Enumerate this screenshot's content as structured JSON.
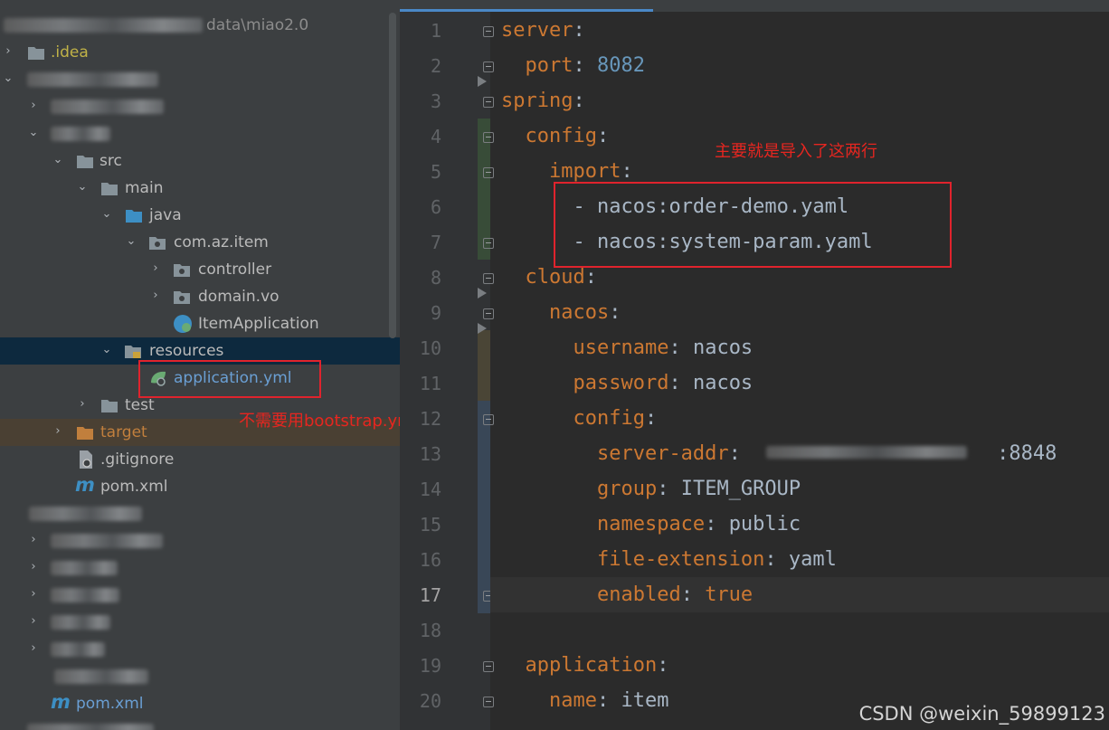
{
  "tree": {
    "project_path": "data\\miao2.0",
    "items": [
      {
        "label": ".idea",
        "style": "yellow"
      },
      {
        "label": "src"
      },
      {
        "label": "main"
      },
      {
        "label": "java"
      },
      {
        "label": "com.az.item"
      },
      {
        "label": "controller"
      },
      {
        "label": "domain.vo"
      },
      {
        "label": "ItemApplication"
      },
      {
        "label": "resources"
      },
      {
        "label": "application.yml",
        "style": "blue"
      },
      {
        "label": "test"
      },
      {
        "label": "target",
        "style": "orange"
      },
      {
        "label": ".gitignore"
      },
      {
        "label": "pom.xml"
      },
      {
        "label": "pom.xml"
      }
    ],
    "annotation": "不需要用bootstrap.yml"
  },
  "editor": {
    "annotation": "主要就是导入了这两行",
    "lines": [
      {
        "n": "1",
        "key": "server",
        "value": ""
      },
      {
        "n": "2",
        "key": "port",
        "value": "8082"
      },
      {
        "n": "3",
        "key": "spring",
        "value": ""
      },
      {
        "n": "4",
        "key": "config",
        "value": ""
      },
      {
        "n": "5",
        "key": "import",
        "value": ""
      },
      {
        "n": "6",
        "item": "- nacos:order-demo.yaml"
      },
      {
        "n": "7",
        "item": "- nacos:system-param.yaml"
      },
      {
        "n": "8",
        "key": "cloud",
        "value": ""
      },
      {
        "n": "9",
        "key": "nacos",
        "value": ""
      },
      {
        "n": "10",
        "key": "username",
        "value": "nacos"
      },
      {
        "n": "11",
        "key": "password",
        "value": "nacos"
      },
      {
        "n": "12",
        "key": "config",
        "value": ""
      },
      {
        "n": "13",
        "key": "server-addr",
        "value": ":8848"
      },
      {
        "n": "14",
        "key": "group",
        "value": "ITEM_GROUP"
      },
      {
        "n": "15",
        "key": "namespace",
        "value": "public"
      },
      {
        "n": "16",
        "key": "file-extension",
        "value": "yaml"
      },
      {
        "n": "17",
        "key": "enabled",
        "value": "true"
      },
      {
        "n": "18"
      },
      {
        "n": "19",
        "key": "application",
        "value": ""
      },
      {
        "n": "20",
        "key": "name",
        "value": "item"
      }
    ],
    "watermark": "CSDN @weixin_59899123"
  },
  "colors": {
    "keyword": "#cc7832",
    "number": "#6897bb",
    "text": "#a9b7c6",
    "annotation": "#e62620",
    "selection": "#0d293e"
  }
}
